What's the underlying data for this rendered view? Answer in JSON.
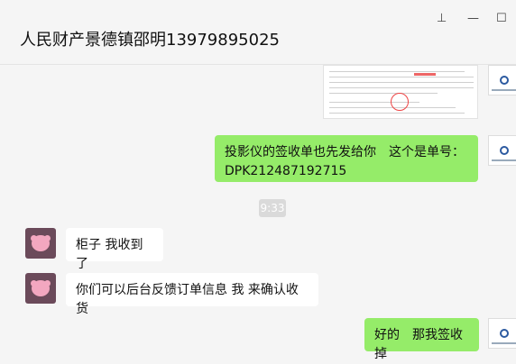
{
  "window": {
    "title": "人民财产景德镇邵明13979895025",
    "buttons": {
      "pin": "⊥",
      "minimize": "—",
      "maximize": "☐"
    }
  },
  "messages": [
    {
      "side": "right",
      "type": "image",
      "icon": "document-thumbnail"
    },
    {
      "side": "right",
      "type": "text",
      "text": "投影仪的签收单也先发给你　这个是单号：DPK212487192715"
    },
    {
      "side": "center",
      "type": "time",
      "text": "9:33"
    },
    {
      "side": "left",
      "type": "text",
      "text": "柜子 我收到了"
    },
    {
      "side": "left",
      "type": "text",
      "text": "你们可以后台反馈订单信息 我 来确认收货"
    },
    {
      "side": "right",
      "type": "text",
      "text": "好的　那我签收掉"
    }
  ],
  "colors": {
    "sent_bubble": "#95ec69",
    "received_bubble": "#ffffff",
    "background": "#f5f5f5"
  }
}
